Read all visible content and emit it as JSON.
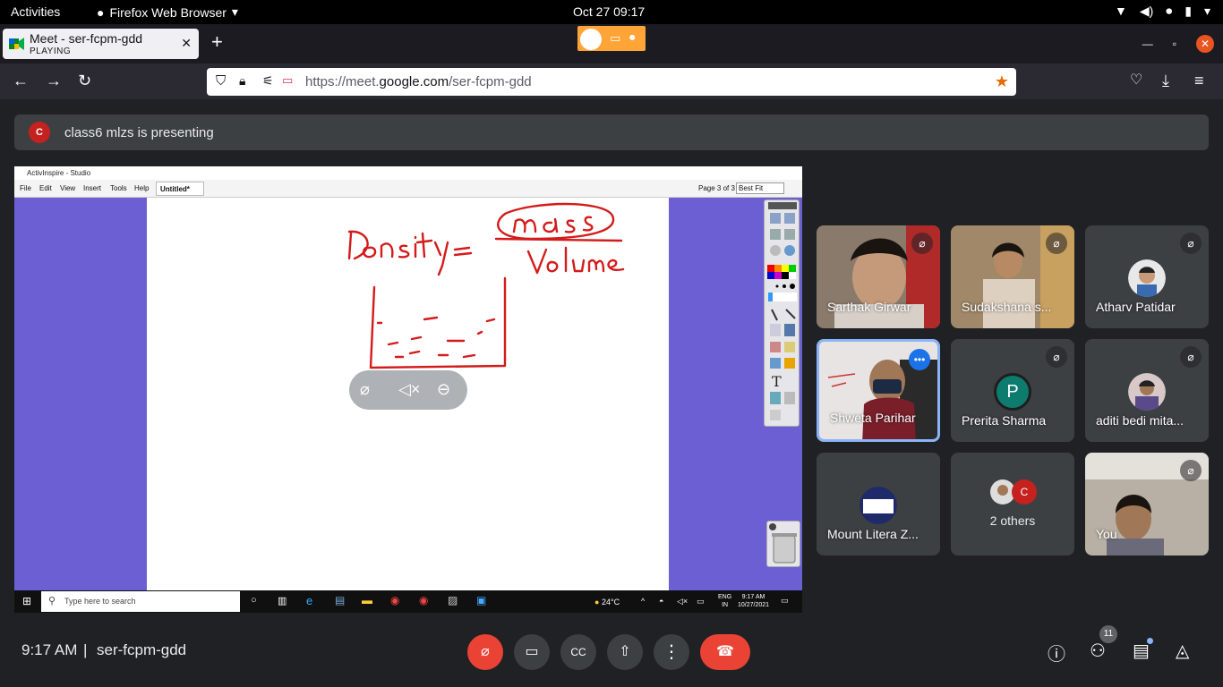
{
  "system": {
    "activities": "Activities",
    "app_name": "Firefox Web Browser",
    "clock": "Oct 27  09:17"
  },
  "browser": {
    "tab_title": "Meet - ser-fcpm-gdd",
    "tab_status": "PLAYING",
    "url_prefix": "https://meet.",
    "url_domain": "google.com",
    "url_path": "/ser-fcpm-gdd"
  },
  "meet": {
    "presenter_initial": "C",
    "presenting_text": "class6 mlzs is presenting",
    "time": "9:17 AM",
    "meeting_code": "ser-fcpm-gdd",
    "participant_count": "11"
  },
  "shared_screen": {
    "app_title": "ActivInspire - Studio",
    "menus": [
      "File",
      "Edit",
      "View",
      "Insert",
      "Tools",
      "Help"
    ],
    "doc_tab": "Untitled*",
    "page_info": "Page 3 of 3",
    "zoom": "Best Fit",
    "taskbar_search": "Type here to search",
    "weather": "24°C",
    "lang_1": "ENG",
    "lang_2": "IN",
    "sys_time": "9:17 AM",
    "sys_date": "10/27/2021"
  },
  "participants": [
    {
      "name": "Sarthak Girwar",
      "muted": true
    },
    {
      "name": "Sudakshana s...",
      "muted": true
    },
    {
      "name": "Atharv Patidar",
      "muted": true
    },
    {
      "name": "Shweta Parihar",
      "muted": false
    },
    {
      "name": "Prerita Sharma",
      "muted": true,
      "initial": "P"
    },
    {
      "name": "aditi bedi mita...",
      "muted": true
    },
    {
      "name": "Mount Litera Z...",
      "muted": false
    },
    {
      "name": "2 others",
      "initial": "C"
    },
    {
      "name": "You",
      "muted": true
    }
  ],
  "colors": {
    "meet_bg": "#202124",
    "tile_bg": "#3c4043",
    "danger": "#ea4335",
    "share_bg": "#6b5fd3",
    "ink": "#d41b1b"
  }
}
